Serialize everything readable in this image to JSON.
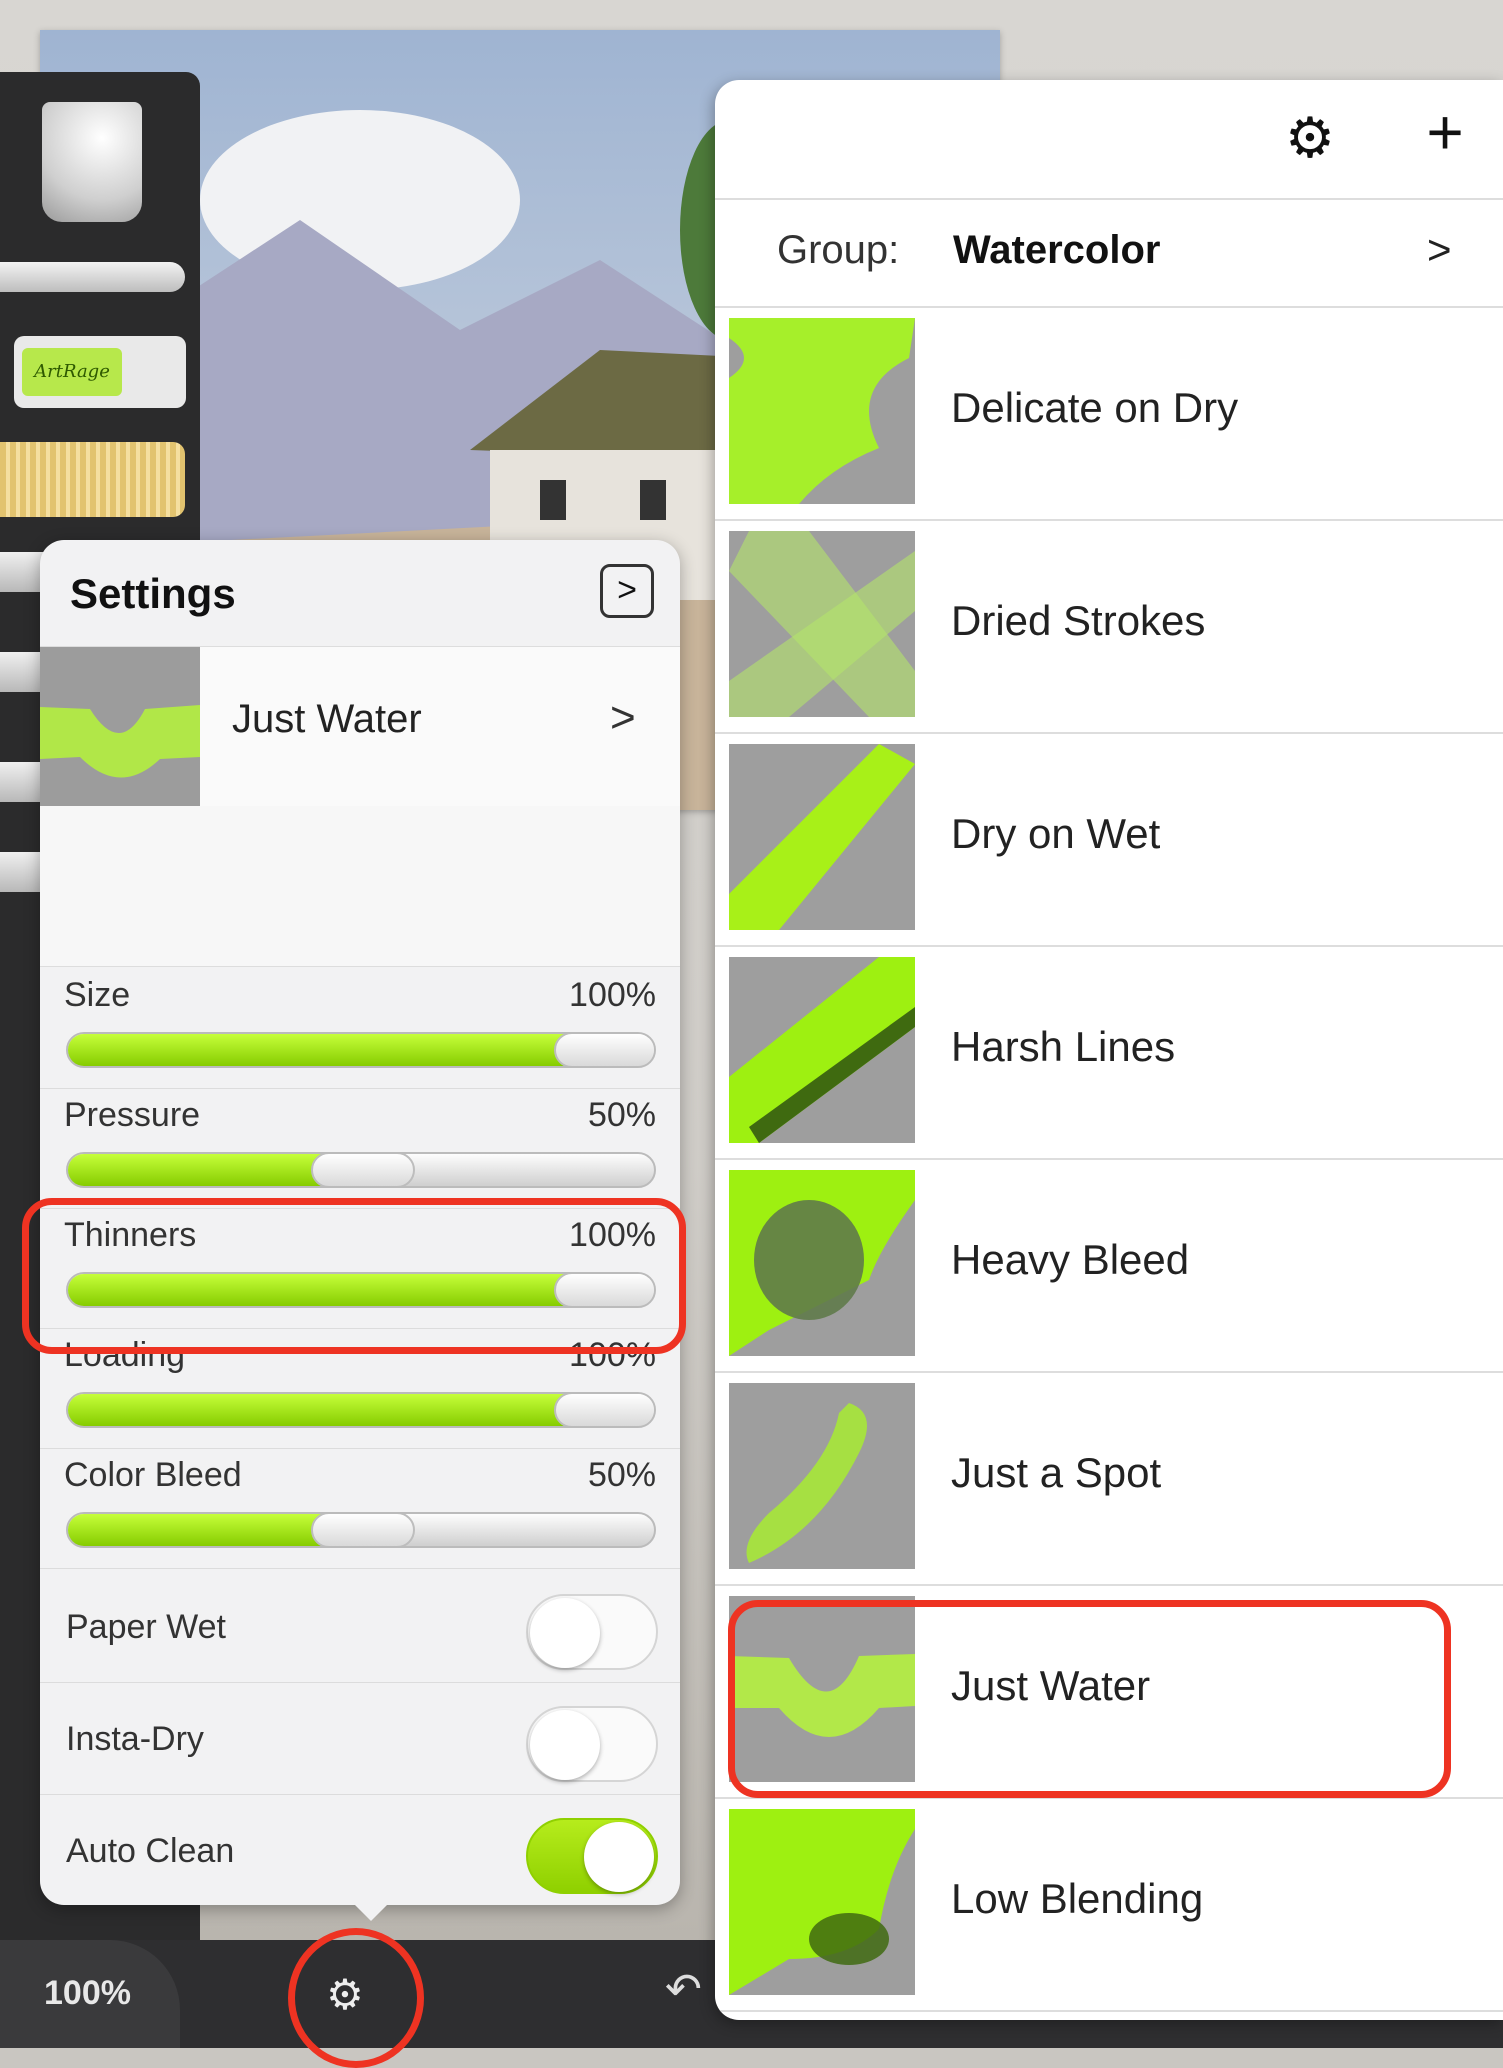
{
  "app": {
    "zoom_label": "100%"
  },
  "toolrail": {
    "tube_label": "ArtRage"
  },
  "settings": {
    "title": "Settings",
    "expand_glyph": ">",
    "preset_name": "Just Water",
    "preset_chevron": ">",
    "sliders": [
      {
        "name": "Size",
        "value_label": "100%",
        "value": 100
      },
      {
        "name": "Pressure",
        "value_label": "50%",
        "value": 50
      },
      {
        "name": "Thinners",
        "value_label": "100%",
        "value": 100
      },
      {
        "name": "Loading",
        "value_label": "100%",
        "value": 100
      },
      {
        "name": "Color Bleed",
        "value_label": "50%",
        "value": 50
      }
    ],
    "toggles": [
      {
        "name": "Paper Wet",
        "on": false
      },
      {
        "name": "Insta-Dry",
        "on": false
      },
      {
        "name": "Auto Clean",
        "on": true
      }
    ]
  },
  "presets": {
    "group_label": "Group:",
    "group_value": "Watercolor",
    "group_chevron": ">",
    "items": [
      {
        "label": "Delicate on Dry"
      },
      {
        "label": "Dried Strokes"
      },
      {
        "label": "Dry on Wet"
      },
      {
        "label": "Harsh Lines"
      },
      {
        "label": "Heavy Bleed"
      },
      {
        "label": "Just a Spot"
      },
      {
        "label": "Just Water"
      },
      {
        "label": "Low Blending"
      }
    ]
  },
  "colors": {
    "accent": "#9be01a",
    "annotation": "#ee3322"
  },
  "icons": {
    "gear": "gear-icon",
    "plus": "plus-icon",
    "undo": "undo-icon",
    "settings_toggle": "settings-gears-icon"
  }
}
